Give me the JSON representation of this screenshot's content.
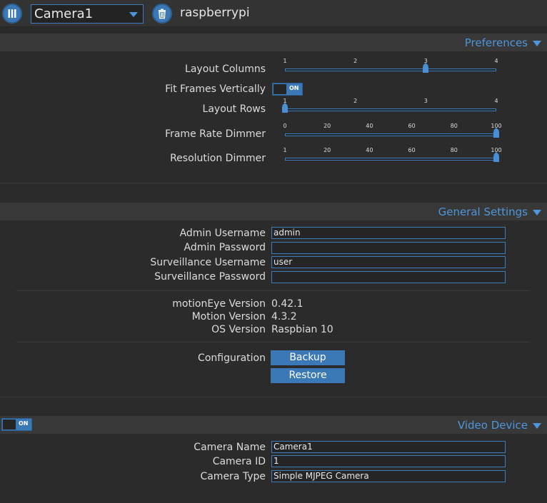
{
  "topbar": {
    "camera_selected": "Camera1",
    "hostname": "raspberrypi",
    "menu_icon": "menu-columns-icon",
    "delete_icon": "trash-icon"
  },
  "preferences": {
    "title": "Preferences",
    "layout_columns": {
      "label": "Layout Columns",
      "ticks": [
        "1",
        "2",
        "3",
        "4"
      ],
      "value": 3,
      "min": 1,
      "max": 4
    },
    "fit_frames": {
      "label": "Fit Frames Vertically",
      "state": "ON"
    },
    "layout_rows": {
      "label": "Layout Rows",
      "ticks": [
        "1",
        "2",
        "3",
        "4"
      ],
      "value": 1,
      "min": 1,
      "max": 4
    },
    "frame_rate_dimmer": {
      "label": "Frame Rate Dimmer",
      "ticks": [
        "0",
        "20",
        "40",
        "60",
        "80",
        "100"
      ],
      "value": 100,
      "min": 0,
      "max": 100
    },
    "resolution_dimmer": {
      "label": "Resolution Dimmer",
      "ticks": [
        "1",
        "20",
        "40",
        "60",
        "80",
        "100"
      ],
      "value": 100,
      "min": 1,
      "max": 100
    }
  },
  "general": {
    "title": "General Settings",
    "admin_username_label": "Admin Username",
    "admin_username": "admin",
    "admin_password_label": "Admin Password",
    "admin_password": "",
    "surv_username_label": "Surveillance Username",
    "surv_username": "user",
    "surv_password_label": "Surveillance Password",
    "surv_password": "",
    "motioneye_version_label": "motionEye Version",
    "motioneye_version": "0.42.1",
    "motion_version_label": "Motion Version",
    "motion_version": "4.3.2",
    "os_version_label": "OS Version",
    "os_version": "Raspbian 10",
    "configuration_label": "Configuration",
    "backup_label": "Backup",
    "restore_label": "Restore"
  },
  "video": {
    "title": "Video Device",
    "toggle_state": "ON",
    "camera_name_label": "Camera Name",
    "camera_name": "Camera1",
    "camera_id_label": "Camera ID",
    "camera_id": "1",
    "camera_type_label": "Camera Type",
    "camera_type": "Simple MJPEG Camera"
  },
  "colors": {
    "accent": "#3a78b6",
    "accent_text": "#4f95dc",
    "background": "#2b2b2b"
  }
}
